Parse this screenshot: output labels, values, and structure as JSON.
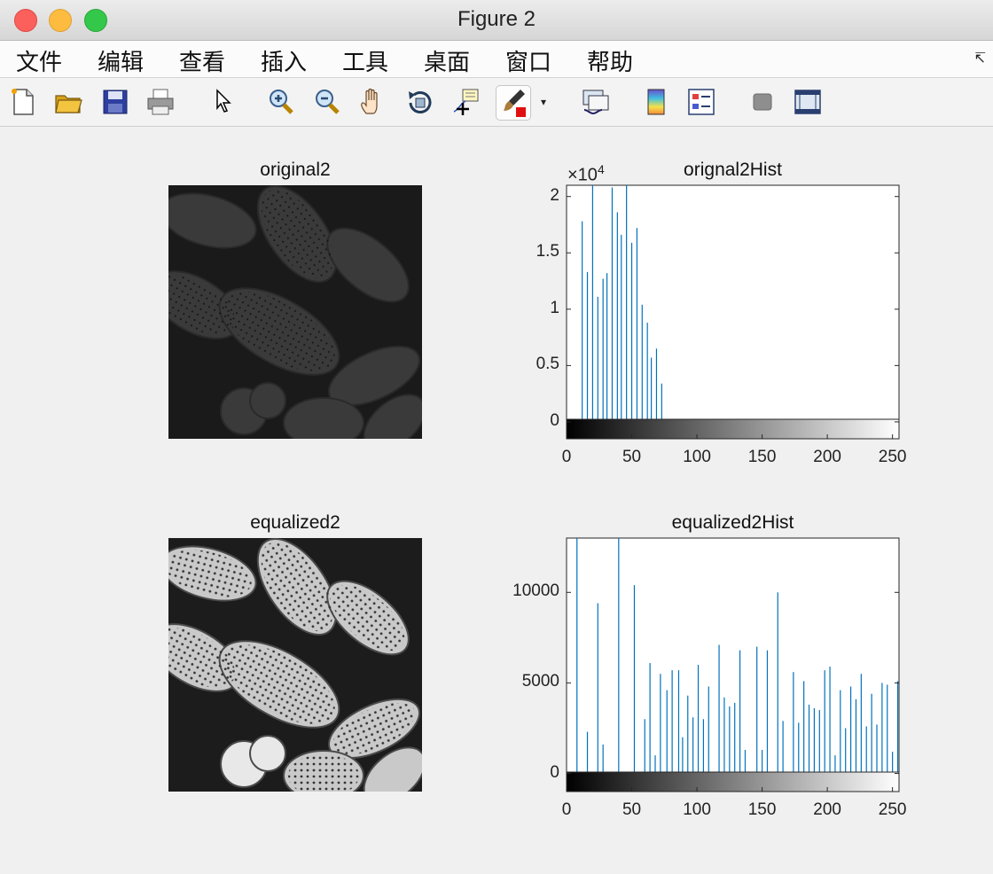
{
  "window": {
    "title": "Figure 2"
  },
  "menu": {
    "items": [
      "文件",
      "编辑",
      "查看",
      "插入",
      "工具",
      "桌面",
      "窗口",
      "帮助"
    ],
    "corner_icon": "dock-arrow-icon"
  },
  "toolbar": {
    "buttons": [
      "new-figure-icon",
      "open-file-icon",
      "save-icon",
      "print-icon",
      "pointer-icon",
      "zoom-in-icon",
      "zoom-out-icon",
      "pan-hand-icon",
      "rotate-3d-icon",
      "data-cursor-icon",
      "brush-icon",
      "link-plot-icon",
      "colorbar-icon",
      "legend-icon",
      "hide-plot-tools-icon",
      "show-plot-tools-icon"
    ],
    "brush_dropdown": "▾"
  },
  "panels": {
    "top_left_title": "original2",
    "bottom_left_title": "equalized2",
    "top_right_title": "orignal2Hist",
    "bottom_right_title": "equalized2Hist",
    "top_right_exponent_base": "×10",
    "top_right_exponent_power": "4"
  },
  "chart_data": [
    {
      "type": "bar",
      "title": "orignal2Hist",
      "xlim": [
        0,
        255
      ],
      "ylim": [
        -1500,
        21000
      ],
      "y_exponent": "×10^4",
      "xticks": [
        "0",
        "50",
        "100",
        "150",
        "200",
        "250"
      ],
      "yticks": [
        "0",
        "0.5",
        "1",
        "1.5",
        "2"
      ],
      "x": [
        12,
        16,
        20,
        24,
        28,
        31,
        35,
        39,
        42,
        46,
        50,
        54,
        58,
        62,
        65,
        69,
        73,
        77,
        81
      ],
      "values": [
        17800,
        13300,
        21000,
        11100,
        12700,
        13200,
        20800,
        18600,
        16600,
        21000,
        15900,
        17200,
        10400,
        8800,
        5700,
        6500,
        3400,
        150,
        20
      ],
      "colorbar": "gray 0–255"
    },
    {
      "type": "bar",
      "title": "equalized2Hist",
      "xlim": [
        0,
        255
      ],
      "ylim": [
        -1000,
        13000
      ],
      "xticks": [
        "0",
        "50",
        "100",
        "150",
        "200",
        "250"
      ],
      "yticks": [
        "0",
        "5000",
        "10000"
      ],
      "x": [
        8,
        16,
        24,
        28,
        40,
        52,
        60,
        64,
        68,
        72,
        77,
        81,
        86,
        89,
        93,
        97,
        101,
        105,
        109,
        113,
        117,
        121,
        125,
        129,
        133,
        137,
        141,
        146,
        150,
        154,
        158,
        162,
        166,
        170,
        174,
        178,
        182,
        186,
        190,
        194,
        198,
        202,
        206,
        210,
        214,
        218,
        222,
        226,
        230,
        234,
        238,
        242,
        246,
        250,
        254
      ],
      "values": [
        13000,
        2300,
        9400,
        1600,
        13000,
        10400,
        3000,
        6100,
        1000,
        5500,
        4600,
        5700,
        5700,
        2000,
        4300,
        3100,
        6000,
        3000,
        4800,
        100,
        7100,
        4200,
        3700,
        3900,
        6800,
        1300,
        100,
        7000,
        1300,
        6800,
        50,
        10000,
        2900,
        50,
        5600,
        2800,
        5100,
        3800,
        3600,
        3500,
        5700,
        5900,
        1000,
        4600,
        2500,
        4800,
        4100,
        5500,
        2600,
        4400,
        2700,
        5000,
        4900,
        1200,
        5100
      ],
      "colorbar": "gray 0–255"
    }
  ]
}
